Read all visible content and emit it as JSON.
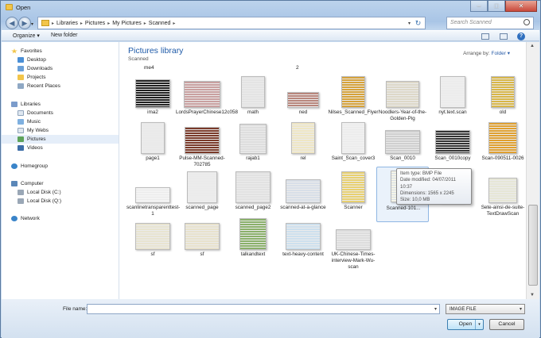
{
  "window": {
    "title": "Open"
  },
  "address": {
    "crumbs": [
      "Libraries",
      "Pictures",
      "My Pictures",
      "Scanned"
    ],
    "search_placeholder": "Search Scanned"
  },
  "toolbar": {
    "organize": "Organize ▾",
    "new_folder": "New folder"
  },
  "nav": {
    "favorites": {
      "label": "Favorites",
      "items": [
        "Desktop",
        "Downloads",
        "Projects",
        "Recent Places"
      ]
    },
    "libraries": {
      "label": "Libraries",
      "items": [
        "Documents",
        "Music",
        "My Webs",
        "Pictures",
        "Videos"
      ]
    },
    "homegroup": "Homegroup",
    "computer": {
      "label": "Computer",
      "items": [
        "Local Disk (C:)",
        "Local Disk (Q:)"
      ]
    },
    "network": "Network"
  },
  "library": {
    "title": "Pictures library",
    "subtitle": "Scanned",
    "arrange_label": "Arrange by:",
    "arrange_value": "Folder ▾"
  },
  "partial_labels": [
    "me4",
    "2"
  ],
  "files": [
    "ima2",
    "LordsPrayerChinese12c058",
    "math",
    "ned",
    "Nilses_Scanned_Flyer",
    "Noodlers-Year-of-the-Golden-Pig",
    "nyt.text.scan",
    "old",
    "page1",
    "Pulse-MM-Scanned-702785",
    "rajab1",
    "rel",
    "Saint_Scan_cover3",
    "Scan_0010",
    "Scan_0010copy",
    "Scan-090511-0026",
    "scanlinetransparenttest-1",
    "scanned_page",
    "scanned_page2",
    "scanned-at-a-glance",
    "Scanner",
    "Scanned-101...",
    "",
    "Sete-ainsi-de-suite-TextDrawScan",
    "sf",
    "sf",
    "talkandtext",
    "text-heavy-content",
    "UK-Chinese-Times-interview-Mark-Wu-scan"
  ],
  "tooltip": {
    "type": "Item type: BMP File",
    "modified": "Date modified: 04/07/2011 10:37",
    "dimensions": "Dimensions: 1565 x 2245",
    "size": "Size: 10,0 MB"
  },
  "footer": {
    "file_name_label": "File name:",
    "file_name_value": "",
    "file_type": "IMAGE FILE",
    "open": "Open",
    "cancel": "Cancel"
  }
}
